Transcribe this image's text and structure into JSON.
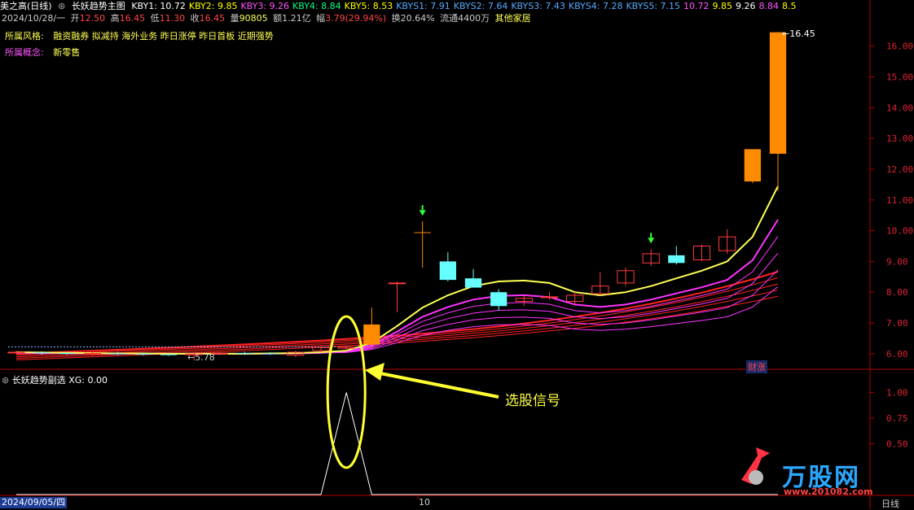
{
  "header": {
    "stock_name": "美之高(日线)",
    "indicator_name": "长妖趋势主图",
    "kby": [
      {
        "label": "KBY1: 10.72",
        "color": "#ffffff"
      },
      {
        "label": "KBY2: 9.85",
        "color": "#ffff00"
      },
      {
        "label": "KBY3: 9.26",
        "color": "#ff55ff"
      },
      {
        "label": "KBY4: 8.84",
        "color": "#00ff88"
      },
      {
        "label": "KBY5: 8.53",
        "color": "#ffff00"
      },
      {
        "label": "KBYS1: 7.91",
        "color": "#55aaff"
      },
      {
        "label": "KBYS2: 7.64",
        "color": "#55aaff"
      },
      {
        "label": "KBYS3: 7.43",
        "color": "#55aaff"
      },
      {
        "label": "KBYS4: 7.28",
        "color": "#55aaff"
      },
      {
        "label": "KBYS5: 7.15",
        "color": "#55aaff"
      },
      {
        "label": "10.72",
        "color": "#ff55ff"
      },
      {
        "label": "9.85",
        "color": "#ffff00"
      },
      {
        "label": "9.26",
        "color": "#ffffff"
      },
      {
        "label": "8.84",
        "color": "#ff55ff"
      },
      {
        "label": "8.5",
        "color": "#ffff00"
      }
    ]
  },
  "info": {
    "date": "2024/10/28/一",
    "open_label": "开",
    "open": "12.50",
    "high_label": "高",
    "high": "16.45",
    "low_label": "低",
    "low": "11.30",
    "close_label": "收",
    "close": "16.45",
    "vol_label": "量",
    "vol": "90805",
    "amount_label": "额",
    "amount": "1.21亿",
    "change_label": "幅",
    "change": "3.79(29.94%)",
    "turnover_label": "换",
    "turnover": "20.64%",
    "float_label": "流通",
    "float": "4400万",
    "others": "其他家居"
  },
  "tags": {
    "style_label": "所属风格:",
    "style_value": "融资融券 拟减持 海外业务 昨日涨停 昨日首板 近期强势",
    "concept_label": "所属概念:",
    "concept_value": "新零售"
  },
  "sub_indicator": {
    "name": "长妖趋势副选",
    "value_label": "XG: 0.00"
  },
  "annotations": {
    "signal_label": "选股信号",
    "high_mark": "16.45",
    "low_mark": "5.78",
    "caizhang": "财涨"
  },
  "bottom": {
    "start_date": "2024/09/05/四",
    "month_tick": "10",
    "period": "日线",
    "logo_text": "万股网",
    "logo_url": "www.201082.com"
  },
  "colors": {
    "up": "#ff3b3b",
    "up_big": "#ff8c00",
    "down": "#66ffff",
    "ma_main": "#ffff55",
    "ma_magenta": "#ff33ff",
    "ma_red": "#ff2222",
    "axis": "#b00000"
  },
  "chart_data": {
    "type": "candlestick",
    "y_axis_ticks": [
      "16.00",
      "15.00",
      "14.00",
      "13.00",
      "12.00",
      "11.00",
      "10.00",
      "9.00",
      "8.00",
      "7.00",
      "6.00"
    ],
    "ylim": [
      5.6,
      16.6
    ],
    "candles": [
      {
        "o": 6.05,
        "h": 6.1,
        "l": 5.98,
        "c": 6.05
      },
      {
        "o": 6.04,
        "h": 6.08,
        "l": 5.97,
        "c": 6.02
      },
      {
        "o": 6.02,
        "h": 6.06,
        "l": 5.96,
        "c": 6.0
      },
      {
        "o": 6.0,
        "h": 6.05,
        "l": 5.95,
        "c": 6.01
      },
      {
        "o": 6.01,
        "h": 6.06,
        "l": 5.96,
        "c": 6.0
      },
      {
        "o": 6.0,
        "h": 6.04,
        "l": 5.94,
        "c": 5.98
      },
      {
        "o": 5.98,
        "h": 6.03,
        "l": 5.93,
        "c": 5.97
      },
      {
        "o": 5.97,
        "h": 6.02,
        "l": 5.78,
        "c": 5.99
      },
      {
        "o": 5.99,
        "h": 6.05,
        "l": 5.95,
        "c": 6.02
      },
      {
        "o": 6.02,
        "h": 6.06,
        "l": 5.96,
        "c": 6.01
      },
      {
        "o": 6.01,
        "h": 6.05,
        "l": 5.96,
        "c": 6.0
      },
      {
        "o": 5.95,
        "h": 6.1,
        "l": 5.9,
        "c": 6.05
      },
      {
        "o": 6.1,
        "h": 6.25,
        "l": 6.05,
        "c": 6.2
      },
      {
        "o": 6.18,
        "h": 6.25,
        "l": 6.1,
        "c": 6.22
      },
      {
        "o": 6.3,
        "h": 7.5,
        "l": 6.2,
        "c": 6.95
      },
      {
        "o": 8.3,
        "h": 8.35,
        "l": 7.35,
        "c": 8.3
      },
      {
        "o": 9.93,
        "h": 10.3,
        "l": 8.8,
        "c": 9.95
      },
      {
        "o": 9.0,
        "h": 9.3,
        "l": 8.35,
        "c": 8.4
      },
      {
        "o": 8.45,
        "h": 8.75,
        "l": 8.15,
        "c": 8.15
      },
      {
        "o": 8.0,
        "h": 8.1,
        "l": 7.4,
        "c": 7.55
      },
      {
        "o": 7.7,
        "h": 7.9,
        "l": 7.55,
        "c": 7.8
      },
      {
        "o": 7.85,
        "h": 8.0,
        "l": 7.75,
        "c": 7.85
      },
      {
        "o": 7.7,
        "h": 8.0,
        "l": 7.6,
        "c": 7.9
      },
      {
        "o": 7.95,
        "h": 8.65,
        "l": 7.9,
        "c": 8.2
      },
      {
        "o": 8.3,
        "h": 8.8,
        "l": 8.2,
        "c": 8.7
      },
      {
        "o": 8.95,
        "h": 9.4,
        "l": 8.85,
        "c": 9.25
      },
      {
        "o": 9.2,
        "h": 9.5,
        "l": 8.9,
        "c": 8.95
      },
      {
        "o": 9.05,
        "h": 9.55,
        "l": 9.0,
        "c": 9.5
      },
      {
        "o": 9.35,
        "h": 10.05,
        "l": 9.25,
        "c": 9.8
      },
      {
        "o": 11.6,
        "h": 12.65,
        "l": 11.55,
        "c": 12.65
      },
      {
        "o": 12.5,
        "h": 16.45,
        "l": 11.3,
        "c": 16.45
      }
    ],
    "ma_main": [
      6.05,
      6.04,
      6.03,
      6.02,
      6.01,
      6.01,
      6.0,
      6.0,
      6.0,
      6.0,
      6.01,
      6.02,
      6.05,
      6.1,
      6.35,
      6.9,
      7.5,
      7.9,
      8.2,
      8.35,
      8.38,
      8.3,
      8.0,
      7.9,
      8.0,
      8.2,
      8.45,
      8.7,
      9.0,
      9.8,
      11.45
    ],
    "sub_xg": [
      0,
      0,
      0,
      0,
      0,
      0,
      0,
      0,
      0,
      0,
      0,
      0,
      0,
      1,
      0,
      0,
      0,
      0,
      0,
      0,
      0,
      0,
      0,
      0,
      0,
      0,
      0,
      0,
      0,
      0,
      0
    ],
    "sub_ylim": [
      0,
      1.1
    ],
    "sub_y_ticks": [
      "1.00",
      "0.75",
      "0.50"
    ]
  }
}
